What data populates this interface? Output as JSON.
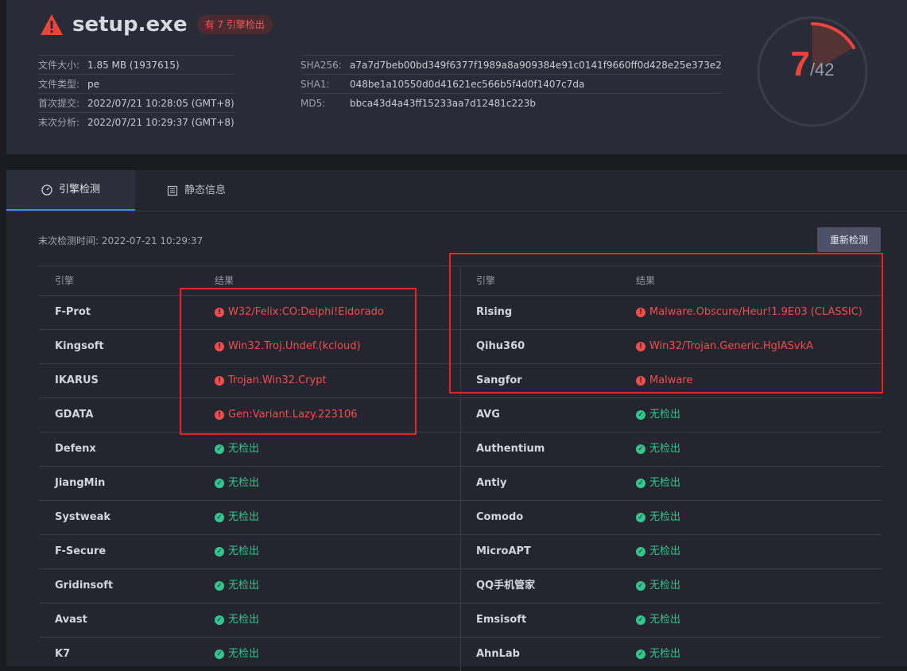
{
  "file": {
    "name": "setup.exe",
    "badge": "有 7 引擎检出"
  },
  "meta_left": [
    {
      "label": "文件大小:",
      "value": "1.85 MB (1937615)"
    },
    {
      "label": "文件类型:",
      "value": "pe"
    },
    {
      "label": "首次提交:",
      "value": "2022/07/21 10:28:05 (GMT+8)"
    },
    {
      "label": "末次分析:",
      "value": "2022/07/21 10:29:37 (GMT+8)"
    }
  ],
  "meta_right": [
    {
      "label": "SHA256:",
      "value": "a7a7d7beb00bd349f6377f1989a8a909384e91c0141f9660ff0d428e25e373e2"
    },
    {
      "label": "SHA1:",
      "value": "048be1a10550d0d41621ec566b5f4d0f1407c7da"
    },
    {
      "label": "MD5:",
      "value": "bbca43d4a43ff15233aa7d12481c223b"
    }
  ],
  "gauge": {
    "detected": "7",
    "total": "/42",
    "fraction": 0.1667,
    "accent": "#e8453c"
  },
  "tabs": {
    "engine": "引擎检测",
    "static": "静态信息"
  },
  "scan": {
    "last": "末次检测时间: 2022-07-21 10:29:37",
    "rescan": "重新检测"
  },
  "table": {
    "header_engine": "引擎",
    "header_result": "结果",
    "left": [
      {
        "engine": "F-Prot",
        "result": "W32/Felix:CO:Delphi!Eldorado",
        "status": "bad"
      },
      {
        "engine": "Kingsoft",
        "result": "Win32.Troj.Undef.(kcloud)",
        "status": "bad"
      },
      {
        "engine": "IKARUS",
        "result": "Trojan.Win32.Crypt",
        "status": "bad"
      },
      {
        "engine": "GDATA",
        "result": "Gen:Variant.Lazy.223106",
        "status": "bad"
      },
      {
        "engine": "Defenx",
        "result": "无检出",
        "status": "ok"
      },
      {
        "engine": "JiangMin",
        "result": "无检出",
        "status": "ok"
      },
      {
        "engine": "Systweak",
        "result": "无检出",
        "status": "ok"
      },
      {
        "engine": "F-Secure",
        "result": "无检出",
        "status": "ok"
      },
      {
        "engine": "Gridinsoft",
        "result": "无检出",
        "status": "ok"
      },
      {
        "engine": "Avast",
        "result": "无检出",
        "status": "ok"
      },
      {
        "engine": "K7",
        "result": "无检出",
        "status": "ok"
      }
    ],
    "right": [
      {
        "engine": "Rising",
        "result": "Malware.Obscure/Heur!1.9E03 (CLASSIC)",
        "status": "bad"
      },
      {
        "engine": "Qihu360",
        "result": "Win32/Trojan.Generic.HgIASvkA",
        "status": "bad"
      },
      {
        "engine": "Sangfor",
        "result": "Malware",
        "status": "bad"
      },
      {
        "engine": "AVG",
        "result": "无检出",
        "status": "ok"
      },
      {
        "engine": "Authentium",
        "result": "无检出",
        "status": "ok"
      },
      {
        "engine": "Antiy",
        "result": "无检出",
        "status": "ok"
      },
      {
        "engine": "Comodo",
        "result": "无检出",
        "status": "ok"
      },
      {
        "engine": "MicroAPT",
        "result": "无检出",
        "status": "ok"
      },
      {
        "engine": "QQ手机管家",
        "result": "无检出",
        "status": "ok"
      },
      {
        "engine": "Emsisoft",
        "result": "无检出",
        "status": "ok"
      },
      {
        "engine": "AhnLab",
        "result": "无检出",
        "status": "ok"
      }
    ]
  },
  "colors": {
    "bad": "#ef4d4d",
    "ok": "#35c48e",
    "accent": "#3d8bf2"
  }
}
